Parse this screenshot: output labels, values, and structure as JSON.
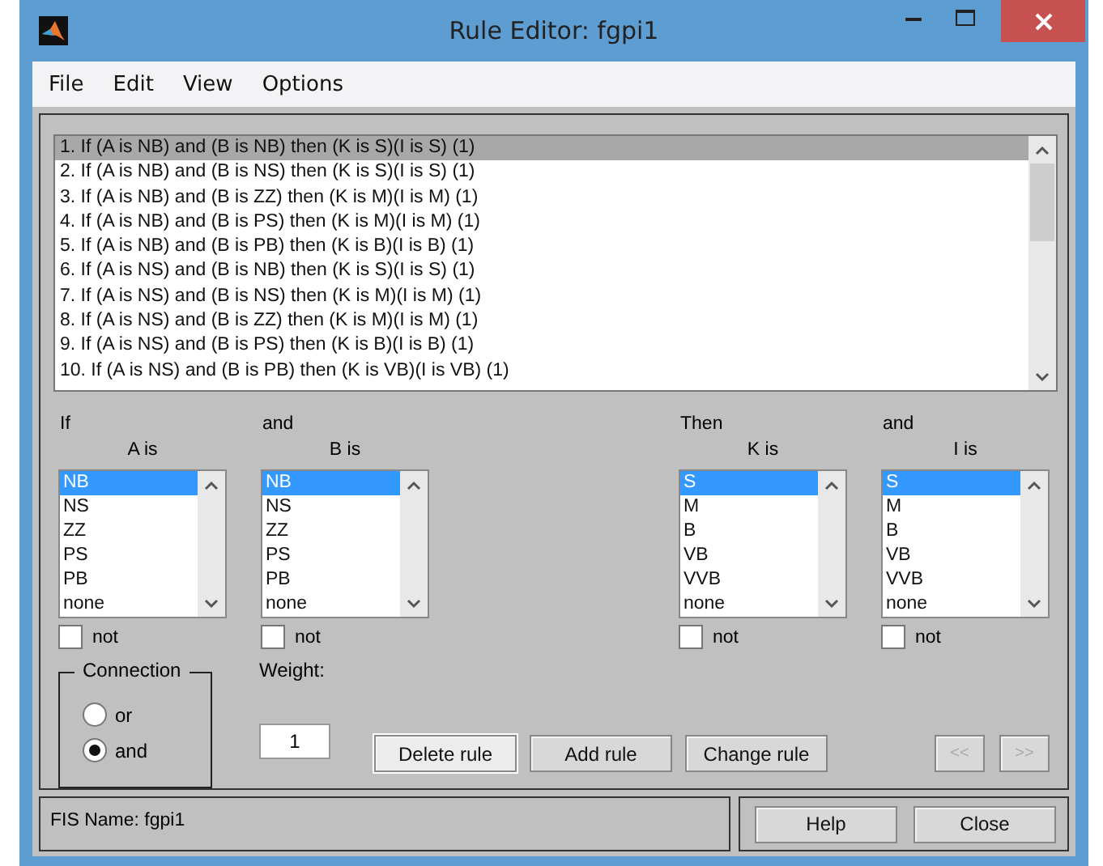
{
  "window": {
    "title": "Rule Editor: fgpi1"
  },
  "menu": [
    "File",
    "Edit",
    "View",
    "Options"
  ],
  "rules": [
    {
      "text": "1. If (A is NB) and (B is NB) then (K is S)(I is S) (1)",
      "selected": true
    },
    {
      "text": "2. If (A is NB) and (B is NS) then (K is S)(I is S) (1)",
      "selected": false
    },
    {
      "text": "3. If (A is NB) and (B is ZZ) then (K is M)(I is M) (1)",
      "selected": false
    },
    {
      "text": "4. If (A is NB) and (B is PS) then (K is M)(I is M) (1)",
      "selected": false
    },
    {
      "text": "5. If (A is NB) and (B is PB) then (K is B)(I is B) (1)",
      "selected": false
    },
    {
      "text": "6. If (A is NS) and (B is NB) then (K is S)(I is S) (1)",
      "selected": false
    },
    {
      "text": "7. If (A is NS) and (B is NS) then (K is M)(I is M) (1)",
      "selected": false
    },
    {
      "text": "8. If (A is NS) and (B is ZZ) then (K is M)(I is M) (1)",
      "selected": false
    },
    {
      "text": "9. If (A is NS) and (B is PS) then (K is B)(I is B) (1)",
      "selected": false
    },
    {
      "text": "10. If (A is NS) and (B is PB) then (K is VB)(I is VB) (1)",
      "selected": false
    }
  ],
  "variables": [
    {
      "heading": "If",
      "label": "A is",
      "not_label": "not",
      "not": false,
      "options": [
        {
          "label": "NB",
          "selected": true
        },
        {
          "label": "NS",
          "selected": false
        },
        {
          "label": "ZZ",
          "selected": false
        },
        {
          "label": "PS",
          "selected": false
        },
        {
          "label": "PB",
          "selected": false
        },
        {
          "label": "none",
          "selected": false
        }
      ]
    },
    {
      "heading": "and",
      "label": "B is",
      "not_label": "not",
      "not": false,
      "options": [
        {
          "label": "NB",
          "selected": true
        },
        {
          "label": "NS",
          "selected": false
        },
        {
          "label": "ZZ",
          "selected": false
        },
        {
          "label": "PS",
          "selected": false
        },
        {
          "label": "PB",
          "selected": false
        },
        {
          "label": "none",
          "selected": false
        }
      ]
    },
    {
      "heading": "Then",
      "label": "K is",
      "not_label": "not",
      "not": false,
      "options": [
        {
          "label": "S",
          "selected": true
        },
        {
          "label": "M",
          "selected": false
        },
        {
          "label": "B",
          "selected": false
        },
        {
          "label": "VB",
          "selected": false
        },
        {
          "label": "VVB",
          "selected": false
        },
        {
          "label": "none",
          "selected": false
        }
      ]
    },
    {
      "heading": "and",
      "label": "I is",
      "not_label": "not",
      "not": false,
      "options": [
        {
          "label": "S",
          "selected": true
        },
        {
          "label": "M",
          "selected": false
        },
        {
          "label": "B",
          "selected": false
        },
        {
          "label": "VB",
          "selected": false
        },
        {
          "label": "VVB",
          "selected": false
        },
        {
          "label": "none",
          "selected": false
        }
      ]
    }
  ],
  "connection": {
    "title": "Connection",
    "options": [
      {
        "label": "or",
        "selected": false
      },
      {
        "label": "and",
        "selected": true
      }
    ]
  },
  "weight": {
    "label": "Weight:",
    "value": "1"
  },
  "rule_buttons": [
    {
      "label": "Delete rule",
      "focused": true
    },
    {
      "label": "Add rule",
      "focused": false
    },
    {
      "label": "Change rule",
      "focused": false
    }
  ],
  "nav_buttons": [
    {
      "label": "<<",
      "disabled": true
    },
    {
      "label": ">>",
      "disabled": true
    }
  ],
  "status": "FIS Name: fgpi1",
  "footer_buttons": [
    "Help",
    "Close"
  ]
}
